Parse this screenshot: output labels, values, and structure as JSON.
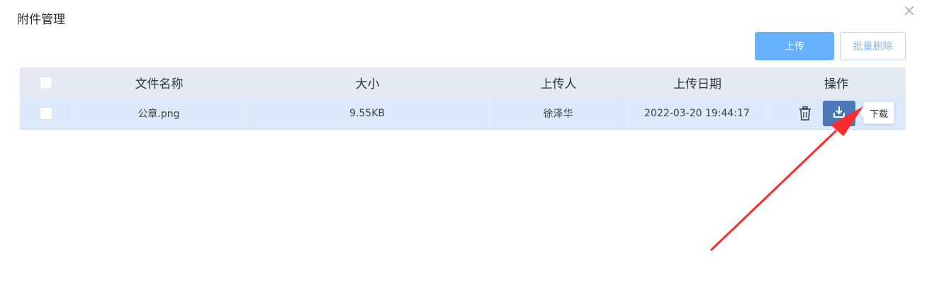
{
  "dialog": {
    "title": "附件管理",
    "close_icon": "×"
  },
  "toolbar": {
    "upload_label": "上传",
    "batch_delete_label": "批量删除"
  },
  "table": {
    "columns": [
      "文件名称",
      "大小",
      "上传人",
      "上传日期",
      "操作"
    ],
    "rows": [
      {
        "name": "公章.png",
        "size": "9.55KB",
        "uploader": "徐泽华",
        "date": "2022-03-20 19:44:17"
      }
    ]
  },
  "tooltip": {
    "text": "下载"
  },
  "icons": {
    "delete": "trash-icon",
    "download": "download-icon",
    "annotation": "red-arrow"
  },
  "colors": {
    "primary": "#66b1ff",
    "download_button": "#4a78b8",
    "row_bg": "#dbe9fb",
    "header_bg": "#e4e9f2",
    "annotation_red": "#ff2a2a"
  }
}
